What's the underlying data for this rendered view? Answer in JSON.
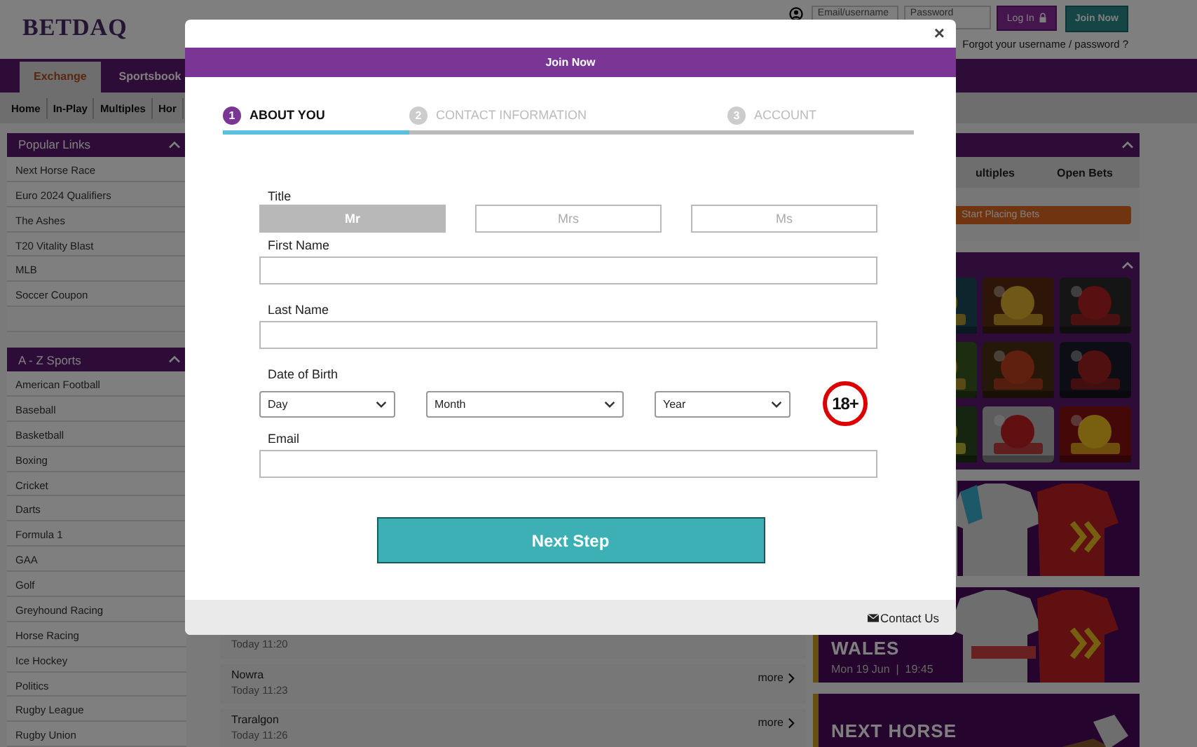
{
  "header": {
    "logo": "BETDAQ",
    "login": {
      "username_placeholder": "Email/username",
      "password_placeholder": "Password",
      "login_button": "Log In",
      "join_button": "Join Now",
      "forgot_link": "Forgot your username / password ?"
    }
  },
  "nav": {
    "tabs": [
      {
        "label": "Exchange",
        "selected": true
      },
      {
        "label": "Sportsbook",
        "selected": false
      }
    ],
    "subnav": [
      "Home",
      "In-Play",
      "Multiples",
      "Hor"
    ]
  },
  "sidebar": {
    "sections": [
      {
        "title": "Popular Links",
        "items": [
          "Next Horse Race",
          "Euro 2024 Qualifiers",
          "The Ashes",
          "T20 Vitality Blast",
          "MLB",
          "Soccer Coupon"
        ]
      },
      {
        "title": "A - Z Sports",
        "items": [
          "American Football",
          "Baseball",
          "Basketball",
          "Boxing",
          "Cricket",
          "Darts",
          "Formula 1",
          "GAA",
          "Golf",
          "Greyhound Racing",
          "Horse Racing",
          "Ice Hockey",
          "Politics",
          "Rugby League",
          "Rugby Union"
        ]
      }
    ]
  },
  "events": [
    {
      "time": "Today 11:20"
    },
    {
      "name": "Nowra",
      "time": "Today 11:23",
      "more": "more"
    },
    {
      "name": "Traralgon",
      "time": "Today 11:26",
      "more": "more"
    }
  ],
  "betslip": {
    "tabs": [
      "ultiples",
      "Open Bets"
    ],
    "button": "Start Placing Bets"
  },
  "games": {
    "tiles": [
      {
        "kind": "picture"
      },
      {
        "kind": "picture"
      },
      {
        "kind": "picture"
      },
      {
        "kind": "picture"
      },
      {
        "kind": "picture"
      },
      {
        "kind": "picture"
      },
      {
        "kind": "picture"
      },
      {
        "kind": "picture"
      },
      {
        "kind": "picture"
      }
    ]
  },
  "banners": [
    {
      "kind": "picture"
    },
    {
      "kind": "picture",
      "title": "WALES",
      "subtitle": "Mon 19 Jun  |  19:45"
    },
    {
      "kind": "picture",
      "title": "NEXT HORSE"
    }
  ],
  "modal": {
    "close": "×",
    "title": "Join Now",
    "steps": [
      {
        "number": "1",
        "label": "ABOUT YOU",
        "selected": true
      },
      {
        "number": "2",
        "label": "CONTACT INFORMATION",
        "selected": false
      },
      {
        "number": "3",
        "label": "ACCOUNT",
        "selected": false
      }
    ],
    "progress": {
      "level": 0.27
    },
    "title_label": "Title",
    "title_options": [
      {
        "label": "Mr",
        "selected": true
      },
      {
        "label": "Mrs",
        "selected": false
      },
      {
        "label": "Ms",
        "selected": false
      }
    ],
    "first_name_label": "First Name",
    "last_name_label": "Last Name",
    "dob_label": "Date of Birth",
    "dob_selects": [
      "Day",
      "Month",
      "Year"
    ],
    "age_badge": "18+",
    "email_label": "Email",
    "next_button": "Next Step",
    "contact": "Contact Us"
  }
}
